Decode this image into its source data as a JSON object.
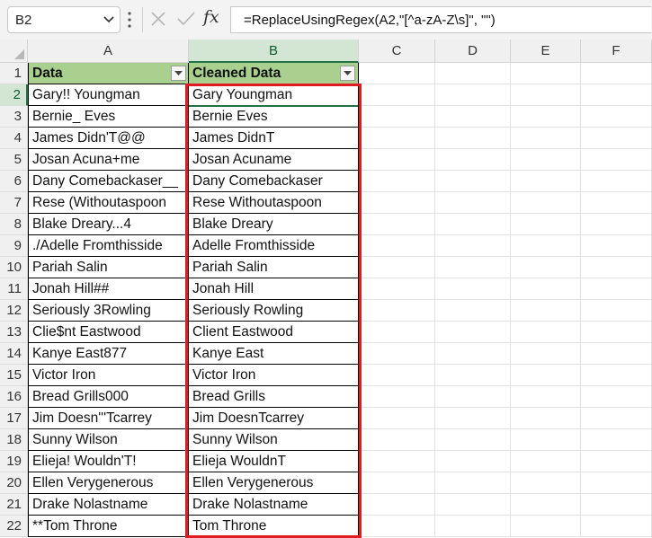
{
  "name_box": "B2",
  "formula": "=ReplaceUsingRegex(A2,\"[^a-zA-Z\\s]\", \"\")",
  "fx_label": "fx",
  "columns": [
    "A",
    "B",
    "C",
    "D",
    "E",
    "F"
  ],
  "header_row": {
    "num": "1",
    "data": "Data",
    "cleaned": "Cleaned Data"
  },
  "rows": [
    {
      "num": "2",
      "data": "Gary!! Youngman",
      "cleaned": "Gary Youngman"
    },
    {
      "num": "3",
      "data": "Bernie_ Eves",
      "cleaned": "Bernie Eves"
    },
    {
      "num": "4",
      "data": "James Didn'T@@",
      "cleaned": "James DidnT"
    },
    {
      "num": "5",
      "data": "Josan Acuna+me",
      "cleaned": "Josan Acuname"
    },
    {
      "num": "6",
      "data": "Dany Comebackaser__",
      "cleaned": "Dany Comebackaser"
    },
    {
      "num": "7",
      "data": "Rese (Withoutaspoon",
      "cleaned": "Rese Withoutaspoon"
    },
    {
      "num": "8",
      "data": "Blake Dreary...4",
      "cleaned": "Blake Dreary"
    },
    {
      "num": "9",
      "data": "./Adelle Fromthisside",
      "cleaned": "Adelle Fromthisside"
    },
    {
      "num": "10",
      "data": "Pariah Salin",
      "cleaned": "Pariah Salin"
    },
    {
      "num": "11",
      "data": "Jonah Hill##",
      "cleaned": "Jonah Hill"
    },
    {
      "num": "12",
      "data": "Seriously 3Rowling",
      "cleaned": "Seriously Rowling"
    },
    {
      "num": "13",
      "data": "Clie$nt Eastwood",
      "cleaned": "Client Eastwood"
    },
    {
      "num": "14",
      "data": "Kanye East877",
      "cleaned": "Kanye East"
    },
    {
      "num": "15",
      "data": "Victor Iron",
      "cleaned": "Victor Iron"
    },
    {
      "num": "16",
      "data": "Bread Grills000",
      "cleaned": "Bread Grills"
    },
    {
      "num": "17",
      "data": "Jim Doesn'''Tcarrey",
      "cleaned": "Jim DoesnTcarrey"
    },
    {
      "num": "18",
      "data": "Sunny Wilson",
      "cleaned": "Sunny Wilson"
    },
    {
      "num": "19",
      "data": "Elieja! Wouldn'T!",
      "cleaned": "Elieja WouldnT"
    },
    {
      "num": "20",
      "data": "Ellen Verygenerous",
      "cleaned": "Ellen Verygenerous"
    },
    {
      "num": "21",
      "data": "Drake Nolastname",
      "cleaned": "Drake Nolastname"
    },
    {
      "num": "22",
      "data": "**Tom Throne",
      "cleaned": "Tom Throne"
    }
  ],
  "colors": {
    "header_fill": "#a9d08e",
    "highlight_border": "#e01b22",
    "selection": "#217346"
  }
}
